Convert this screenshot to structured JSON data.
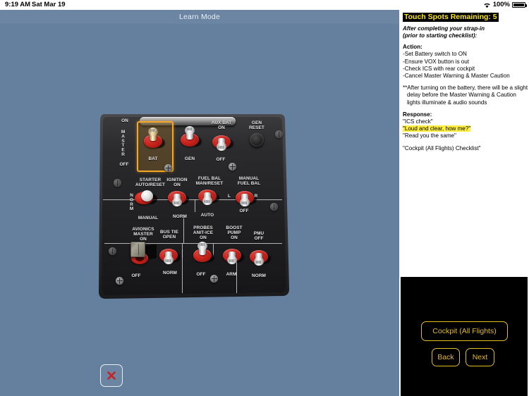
{
  "statusbar": {
    "time": "9:19 AM",
    "date": "Sat Mar 19",
    "battery_percent": "100%",
    "wifi_icon": "wifi-icon",
    "battery_icon": "battery-full-icon"
  },
  "header": {
    "title": "Learn Mode"
  },
  "left": {
    "close_icon": "close-x-icon"
  },
  "panel": {
    "master_on": "ON",
    "master_label": "MASTER",
    "master_off": "OFF",
    "bat": "BAT",
    "gen": "GEN",
    "aux_bat": "AUX BAT\nON",
    "aux_bat_off": "OFF",
    "gen_reset": "GEN\nRESET",
    "starter": "STARTER\nAUTO/RESET",
    "starter_norm": "NORM",
    "starter_manual": "MANUAL",
    "ignition": "IGNITION\nON",
    "ignition_norm": "NORM",
    "fuel_bal": "FUEL BAL\nMAN/RESET",
    "fuel_bal_auto": "AUTO",
    "manual_fuel_bal": "MANUAL\nFUEL BAL",
    "mfb_l": "L",
    "mfb_r": "R",
    "mfb_off": "OFF",
    "avionics": "AVIONICS\nMASTER\nON",
    "avionics_off": "OFF",
    "bus_tie": "BUS TIE\nOPEN",
    "bus_tie_norm": "NORM",
    "probes": "PROBES\nANIT-ICE\nON",
    "probes_off": "OFF",
    "boost_pump": "BOOST\nPUMP\nON",
    "boost_pump_arm": "ARM",
    "pmu": "PMU\nOFF",
    "pmu_norm": "NORM"
  },
  "instructions": {
    "touch_spots": "Touch Spots Remaining: 5",
    "intro_line1": "After completing your strap-in",
    "intro_line2": "(prior to starting checklist):",
    "action_heading": "Action:",
    "actions": [
      "-Set Battery switch to ON",
      "-Ensure VOX button is out",
      "-Check ICS with rear cockpit",
      "-Cancel Master Warning & Master Caution"
    ],
    "note": "**After turning on the battery, there will be a slight delay before the Master Warning & Caution lights illuminate & audio sounds",
    "response_heading": "Response:",
    "response_1": "\"ICS check\"",
    "response_2_highlighted": "\"Loud and clear, how me?\"",
    "response_3": "\"Read you the same\"",
    "checklist_ref": "\"Cockpit (All Flights) Checklist\""
  },
  "nav": {
    "cockpit_label": "Cockpit (All Flights)",
    "back_label": "Back",
    "next_label": "Next"
  },
  "colors": {
    "background": "#657f9e",
    "titlebar": "#6b85a3",
    "highlight_box": "#f5a623",
    "text_highlight": "#ffef3f",
    "button_yellow": "#e3bc22",
    "banner_yellow": "#ffe800"
  }
}
